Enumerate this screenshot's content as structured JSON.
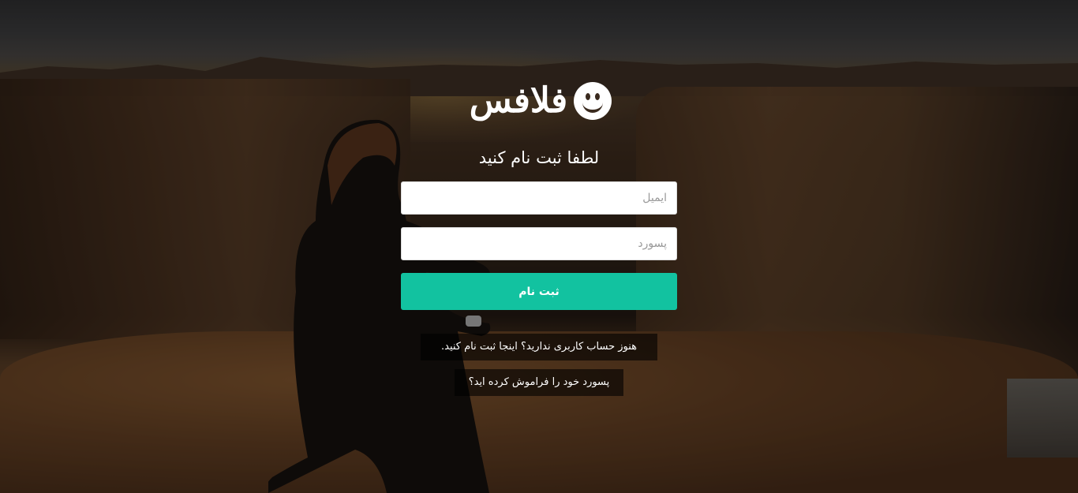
{
  "brand": {
    "name": "فلافس",
    "logo_icon": "smiley-icon"
  },
  "form": {
    "heading": "لطفا ثبت نام کنید",
    "email": {
      "placeholder": "ایمیل",
      "value": ""
    },
    "password": {
      "placeholder": "پسورد",
      "value": ""
    },
    "submit_label": "ثبت نام",
    "submit_color": "#12c2a0"
  },
  "links": {
    "signup": "هنوز حساب کاربری ندارید؟ اینجا ثبت نام کنید.",
    "forgot_password": "پسورد خود را فراموش کرده اید؟"
  }
}
